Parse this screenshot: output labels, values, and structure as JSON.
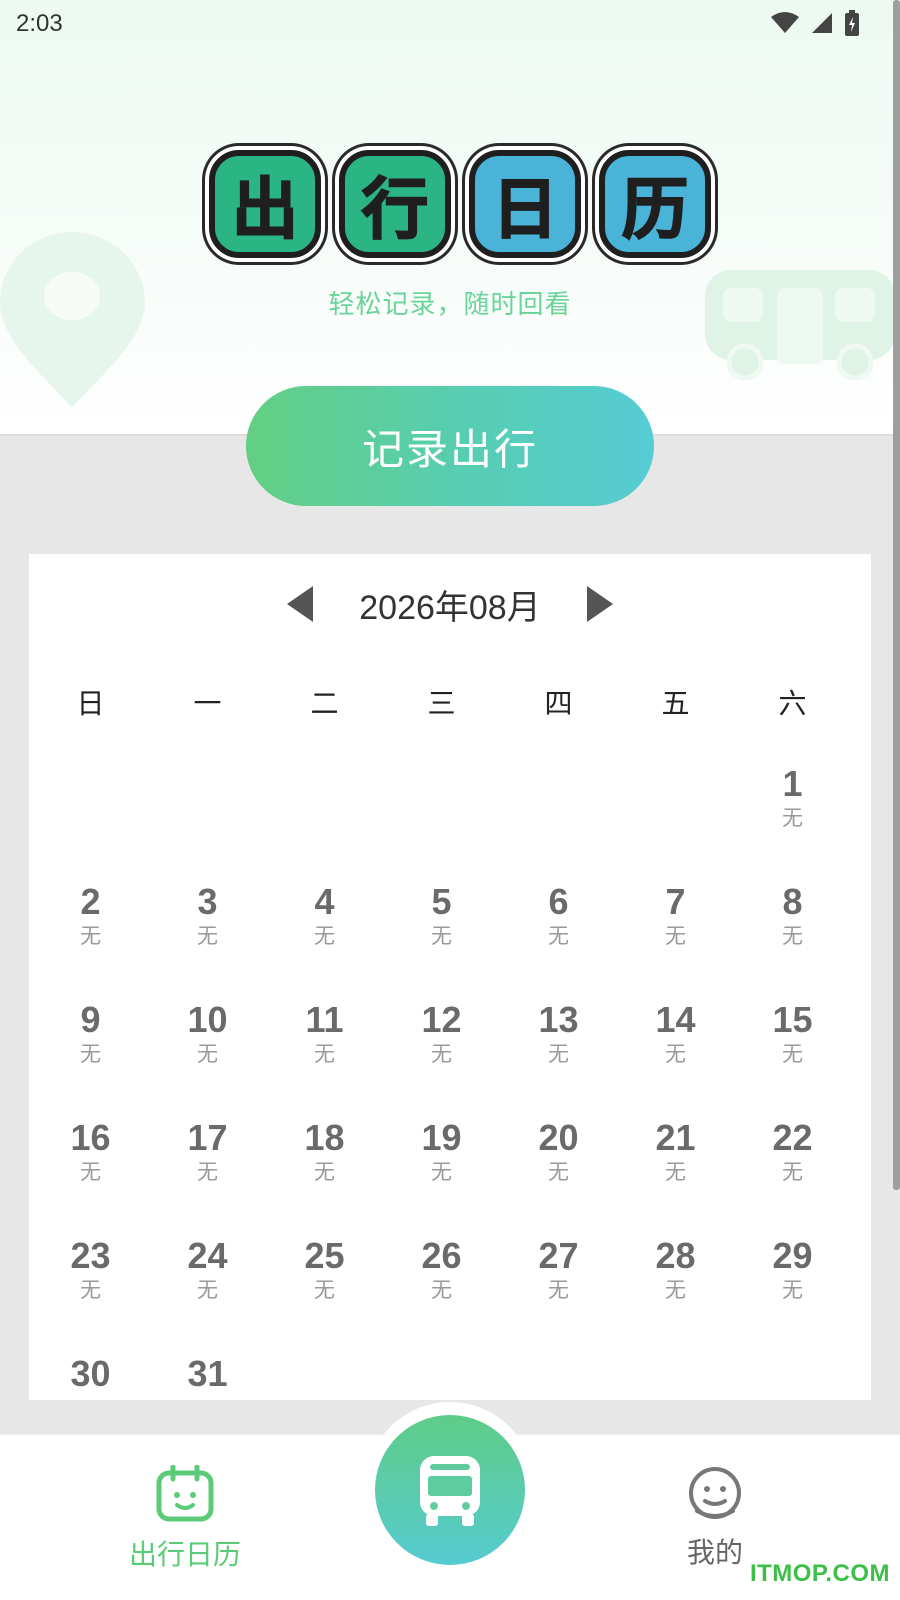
{
  "status_bar": {
    "time": "2:03"
  },
  "header": {
    "logo_chars": [
      "出",
      "行",
      "日",
      "历"
    ],
    "subtitle": "轻松记录，随时回看",
    "record_button": "记录出行"
  },
  "calendar": {
    "month_title": "2026年08月",
    "weekdays": [
      "日",
      "一",
      "二",
      "三",
      "四",
      "五",
      "六"
    ],
    "days": [
      {
        "num": "1",
        "note": "无"
      },
      {
        "num": "2",
        "note": "无"
      },
      {
        "num": "3",
        "note": "无"
      },
      {
        "num": "4",
        "note": "无"
      },
      {
        "num": "5",
        "note": "无"
      },
      {
        "num": "6",
        "note": "无"
      },
      {
        "num": "7",
        "note": "无"
      },
      {
        "num": "8",
        "note": "无"
      },
      {
        "num": "9",
        "note": "无"
      },
      {
        "num": "10",
        "note": "无"
      },
      {
        "num": "11",
        "note": "无"
      },
      {
        "num": "12",
        "note": "无"
      },
      {
        "num": "13",
        "note": "无"
      },
      {
        "num": "14",
        "note": "无"
      },
      {
        "num": "15",
        "note": "无"
      },
      {
        "num": "16",
        "note": "无"
      },
      {
        "num": "17",
        "note": "无"
      },
      {
        "num": "18",
        "note": "无"
      },
      {
        "num": "19",
        "note": "无"
      },
      {
        "num": "20",
        "note": "无"
      },
      {
        "num": "21",
        "note": "无"
      },
      {
        "num": "22",
        "note": "无"
      },
      {
        "num": "23",
        "note": "无"
      },
      {
        "num": "24",
        "note": "无"
      },
      {
        "num": "25",
        "note": "无"
      },
      {
        "num": "26",
        "note": "无"
      },
      {
        "num": "27",
        "note": "无"
      },
      {
        "num": "28",
        "note": "无"
      },
      {
        "num": "29",
        "note": "无"
      },
      {
        "num": "30",
        "note": ""
      },
      {
        "num": "31",
        "note": ""
      }
    ]
  },
  "bottom_nav": {
    "calendar_label": "出行日历",
    "mine_label": "我的"
  },
  "watermark": "ITMOP.COM",
  "colors": {
    "accent_green": "#5ccb78",
    "accent_teal": "#56ccd4",
    "logo_green": "#2bb585",
    "logo_blue": "#49b3d8"
  },
  "icons": {
    "wifi": "wifi-icon",
    "signal": "signal-icon",
    "battery": "battery-icon",
    "prev": "caret-left-icon",
    "next": "caret-right-icon",
    "calendar_tab": "calendar-smile-icon",
    "fab": "bus-icon",
    "mine_tab": "face-icon"
  }
}
